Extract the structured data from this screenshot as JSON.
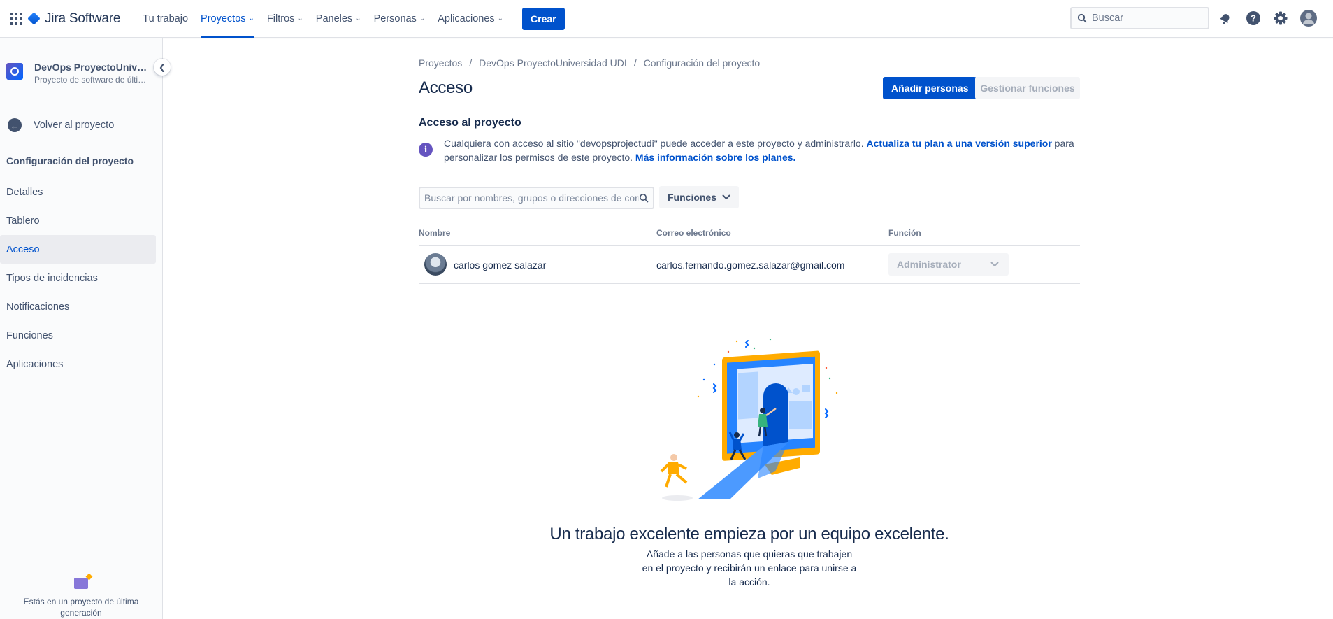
{
  "topnav": {
    "product": "Jira Software",
    "items": [
      {
        "label": "Tu trabajo",
        "has_menu": false,
        "active": false
      },
      {
        "label": "Proyectos",
        "has_menu": true,
        "active": true
      },
      {
        "label": "Filtros",
        "has_menu": true,
        "active": false
      },
      {
        "label": "Paneles",
        "has_menu": true,
        "active": false
      },
      {
        "label": "Personas",
        "has_menu": true,
        "active": false
      },
      {
        "label": "Aplicaciones",
        "has_menu": true,
        "active": false
      }
    ],
    "create_label": "Crear",
    "search_placeholder": "Buscar",
    "icons": [
      "notifications-icon",
      "help-icon",
      "settings-icon",
      "profile-avatar"
    ]
  },
  "sidebar": {
    "project_name": "DevOps ProyectoUniversidad UDI",
    "project_type": "Proyecto de software de última generación",
    "back_label": "Volver al proyecto",
    "section_title": "Configuración del proyecto",
    "items": [
      {
        "label": "Detalles",
        "active": false
      },
      {
        "label": "Tablero",
        "active": false
      },
      {
        "label": "Acceso",
        "active": true
      },
      {
        "label": "Tipos de incidencias",
        "active": false
      },
      {
        "label": "Notificaciones",
        "active": false
      },
      {
        "label": "Funciones",
        "active": false
      },
      {
        "label": "Aplicaciones",
        "active": false
      }
    ],
    "footer_text": "Estás en un proyecto de última generación"
  },
  "main": {
    "breadcrumbs": [
      "Proyectos",
      "DevOps ProyectoUniversidad UDI",
      "Configuración del proyecto"
    ],
    "title": "Acceso",
    "add_people_label": "Añadir personas",
    "manage_roles_label": "Gestionar funciones",
    "access_heading": "Acceso al proyecto",
    "info_text_1": "Cualquiera con acceso al sitio \"devopsprojectudi\" puede acceder a este proyecto y administrarlo. ",
    "info_link_1": "Actualiza tu plan a una versión superior",
    "info_text_2": " para personalizar los permisos de este proyecto. ",
    "info_link_2": "Más información sobre los planes.",
    "filter_placeholder": "Buscar por nombres, grupos o direcciones de correo electrónico",
    "roles_button": "Funciones",
    "table": {
      "headers": [
        "Nombre",
        "Correo electrónico",
        "Función"
      ],
      "rows": [
        {
          "name": "carlos gomez salazar",
          "email": "carlos.fernando.gomez.salazar@gmail.com",
          "role": "Administrator"
        }
      ]
    },
    "empty_heading": "Un trabajo excelente empieza por un equipo excelente.",
    "empty_text": "Añade a las personas que quieras que trabajen en el proyecto y recibirán un enlace para unirse a la acción."
  },
  "colors": {
    "primary": "#0052cc",
    "text": "#172b4d",
    "muted": "#42526e",
    "info_icon": "#6554c0"
  }
}
